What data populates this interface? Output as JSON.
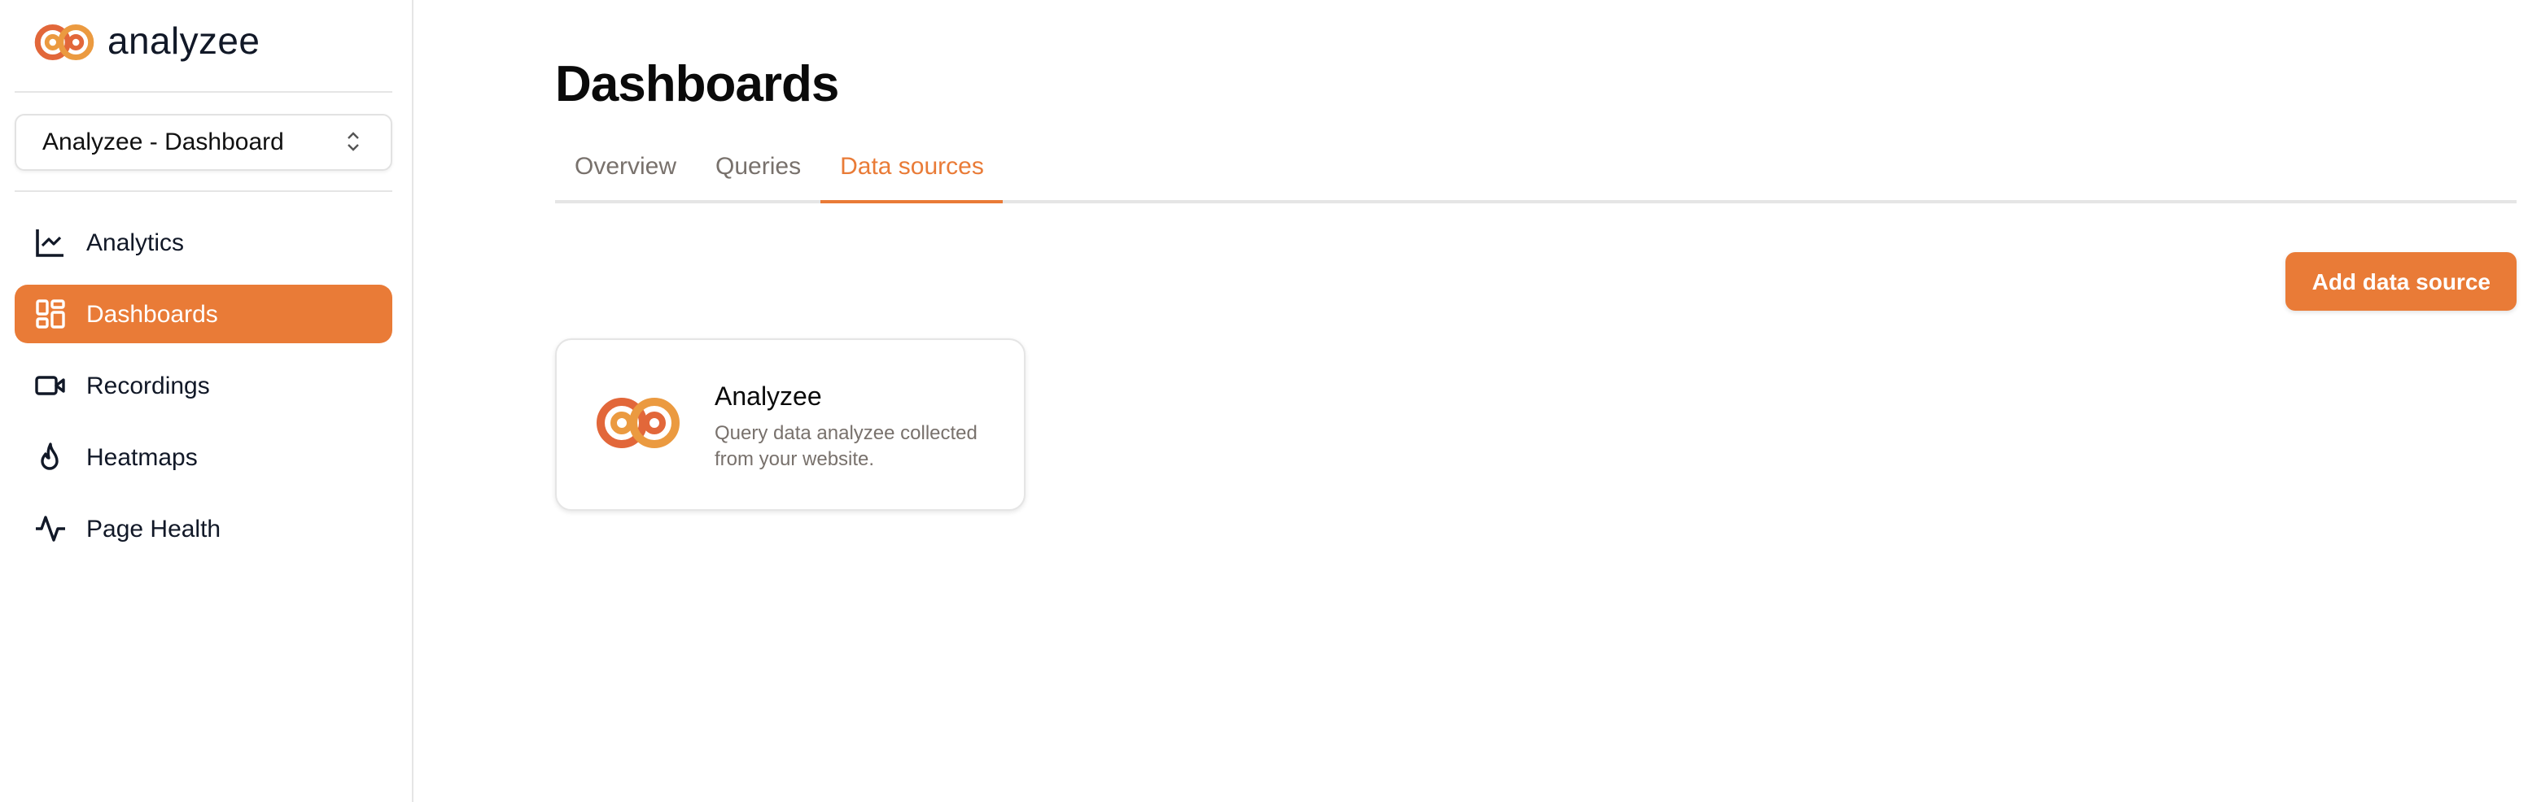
{
  "app": {
    "brand_name": "analyzee",
    "accent_color": "#e97b37"
  },
  "sidebar": {
    "project_selector": {
      "value": "Analyzee - Dashboard",
      "icon": "chevrons-up-down-icon"
    },
    "items": [
      {
        "label": "Analytics",
        "icon": "line-chart-icon",
        "active": false
      },
      {
        "label": "Dashboards",
        "icon": "layout-dashboard-icon",
        "active": true
      },
      {
        "label": "Recordings",
        "icon": "video-camera-icon",
        "active": false
      },
      {
        "label": "Heatmaps",
        "icon": "flame-icon",
        "active": false
      },
      {
        "label": "Page Health",
        "icon": "activity-icon",
        "active": false
      }
    ]
  },
  "main": {
    "title": "Dashboards",
    "tabs": [
      {
        "label": "Overview",
        "active": false
      },
      {
        "label": "Queries",
        "active": false
      },
      {
        "label": "Data sources",
        "active": true
      }
    ],
    "add_button_label": "Add data source",
    "data_sources": [
      {
        "name": "Analyzee",
        "description": "Query data analyzee collected from your website.",
        "icon": "analyzee-logo-icon"
      }
    ]
  }
}
